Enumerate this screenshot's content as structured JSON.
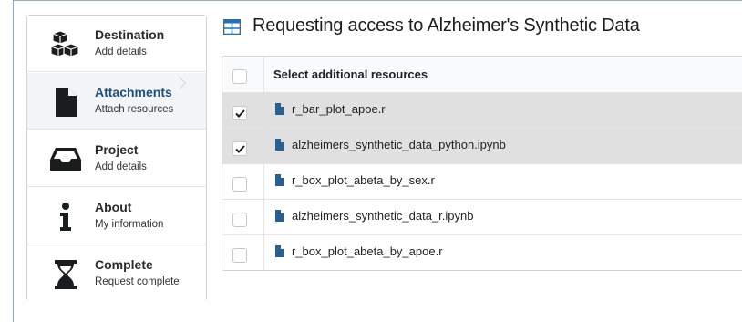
{
  "steps": [
    {
      "title": "Destination",
      "description": "Add details",
      "icon": "cubes-icon"
    },
    {
      "title": "Attachments",
      "description": "Attach resources",
      "icon": "file-icon",
      "active": true
    },
    {
      "title": "Project",
      "description": "Add details",
      "icon": "inbox-icon"
    },
    {
      "title": "About",
      "description": "My information",
      "icon": "info-icon"
    },
    {
      "title": "Complete",
      "description": "Request complete",
      "icon": "hourglass-icon"
    }
  ],
  "header": {
    "icon": "table-icon",
    "title": "Requesting access to Alzheimer's Synthetic Data"
  },
  "resources": {
    "header_label": "Select additional resources",
    "items": [
      {
        "name": "r_bar_plot_apoe.r",
        "checked": true
      },
      {
        "name": "alzheimers_synthetic_data_python.ipynb",
        "checked": true
      },
      {
        "name": "r_box_plot_abeta_by_sex.r",
        "checked": false
      },
      {
        "name": "alzheimers_synthetic_data_r.ipynb",
        "checked": false
      },
      {
        "name": "r_box_plot_abeta_by_apoe.r",
        "checked": false
      }
    ]
  },
  "colors": {
    "active_step_title": "#1f4f7d",
    "table_icon": "#2a6fa8",
    "selected_row": "#e0e0e0"
  }
}
